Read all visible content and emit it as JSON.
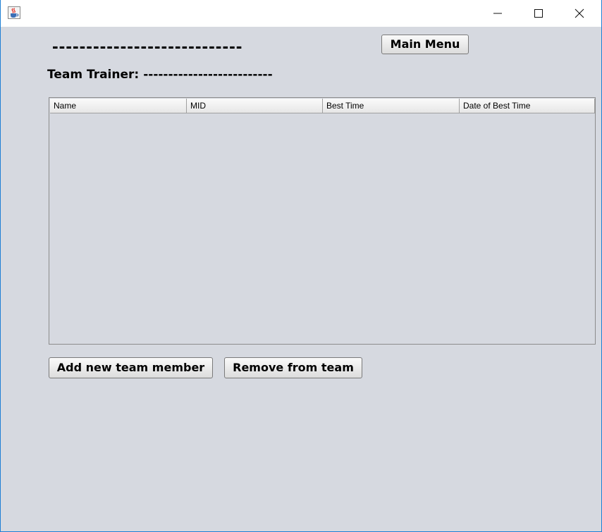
{
  "window": {
    "icon": "java-coffee-icon",
    "controls": {
      "minimize": "minimize-icon",
      "maximize": "maximize-icon",
      "close": "close-icon"
    }
  },
  "header": {
    "team_name": "----------------------------",
    "main_menu_label": "Main Menu"
  },
  "trainer": {
    "label": "Team Trainer:",
    "value": "--------------------------"
  },
  "table": {
    "columns": [
      "Name",
      "MID",
      "Best Time",
      "Date of Best Time"
    ],
    "rows": []
  },
  "actions": {
    "add_label": "Add new team member",
    "remove_label": "Remove from team"
  },
  "colors": {
    "background": "#d6d9e0",
    "window_border": "#1e7fd4"
  }
}
